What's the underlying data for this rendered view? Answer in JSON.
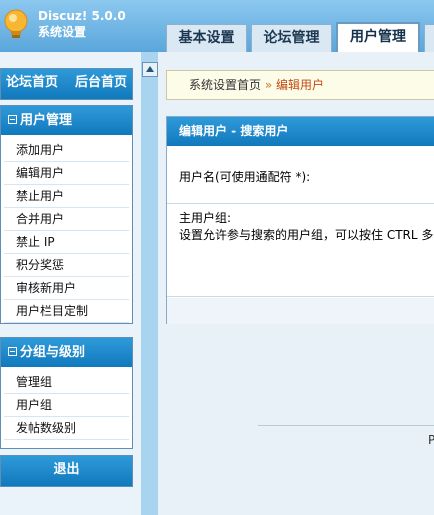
{
  "header": {
    "brand_name": "Discuz! 5.0.0",
    "brand_subtitle": "系统设置",
    "tabs": [
      {
        "label": "基本设置",
        "active": false
      },
      {
        "label": "论坛管理",
        "active": false
      },
      {
        "label": "用户管理",
        "active": true
      }
    ]
  },
  "sidebar": {
    "top_links": {
      "forum_home": "论坛首页",
      "admin_home": "后台首页"
    },
    "sections": [
      {
        "title": "用户管理",
        "items": [
          "添加用户",
          "编辑用户",
          "禁止用户",
          "合并用户",
          "禁止 IP",
          "积分奖惩",
          "审核新用户",
          "用户栏目定制"
        ]
      },
      {
        "title": "分组与级别",
        "items": [
          "管理组",
          "用户组",
          "发帖数级别"
        ]
      }
    ],
    "logout": "退出"
  },
  "breadcrumb": {
    "root": "系统设置首页",
    "separator": "»",
    "current": "编辑用户"
  },
  "panel": {
    "title": "编辑用户 - 搜索用户",
    "username_label": "用户名(可使用通配符 *):",
    "usergroup_label": "主用户组:",
    "usergroup_desc": "设置允许参与搜索的用户组，可以按住 CTRL 多"
  },
  "footer": {
    "text": "P"
  },
  "colors": {
    "header_blue": "#1079bd",
    "breadcrumb_accent": "#c24a14",
    "page_bg": "#e8f1f8"
  }
}
